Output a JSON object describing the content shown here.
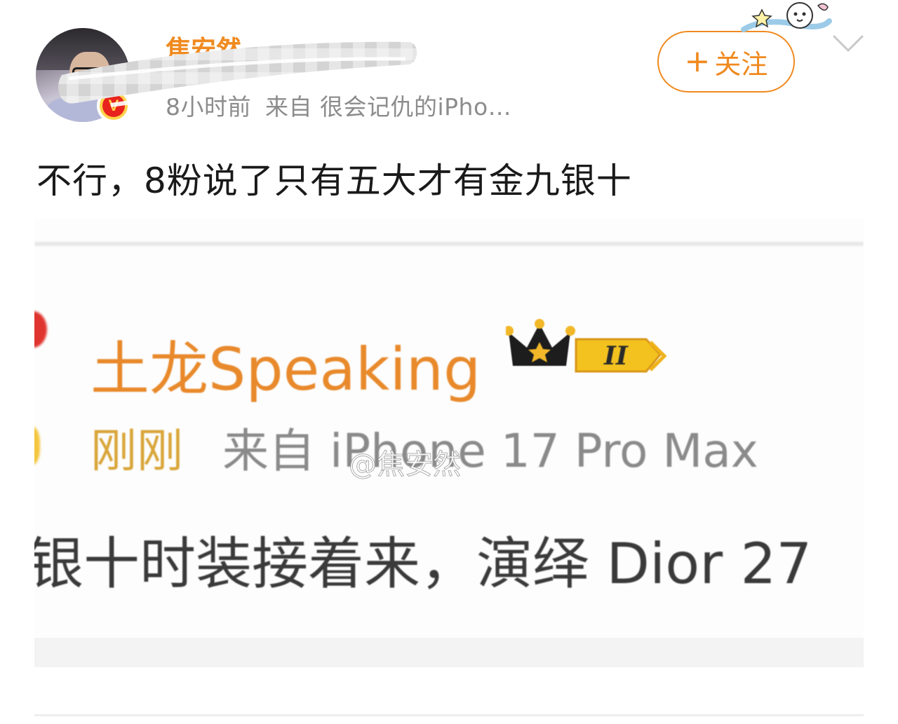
{
  "post": {
    "author": {
      "name": "焦安然",
      "verified_badge": "V"
    },
    "meta": {
      "time": "8小时前",
      "from": "来自 很会记仇的iPho…"
    },
    "follow_label": "关注",
    "follow_plus": "+",
    "text": "不行，8粉说了只有五大才有金九银十"
  },
  "embedded_image": {
    "username": "土龙Speaking",
    "level_badge": "II",
    "time": "刚刚",
    "source": "来自 iPhone 17 Pro Max",
    "watermark": "@焦安然",
    "body_fragment": "银十时装接着来，演绎 Dior 27"
  },
  "colors": {
    "accent_orange": "#f08a1f",
    "meta_gray": "#8c8c8c",
    "verified_red": "#e8231d",
    "verified_yellow": "#ffd24a"
  },
  "icons": {
    "more": "chevron-down-icon",
    "sticker": "sticker-icon",
    "crown": "crown-icon"
  }
}
